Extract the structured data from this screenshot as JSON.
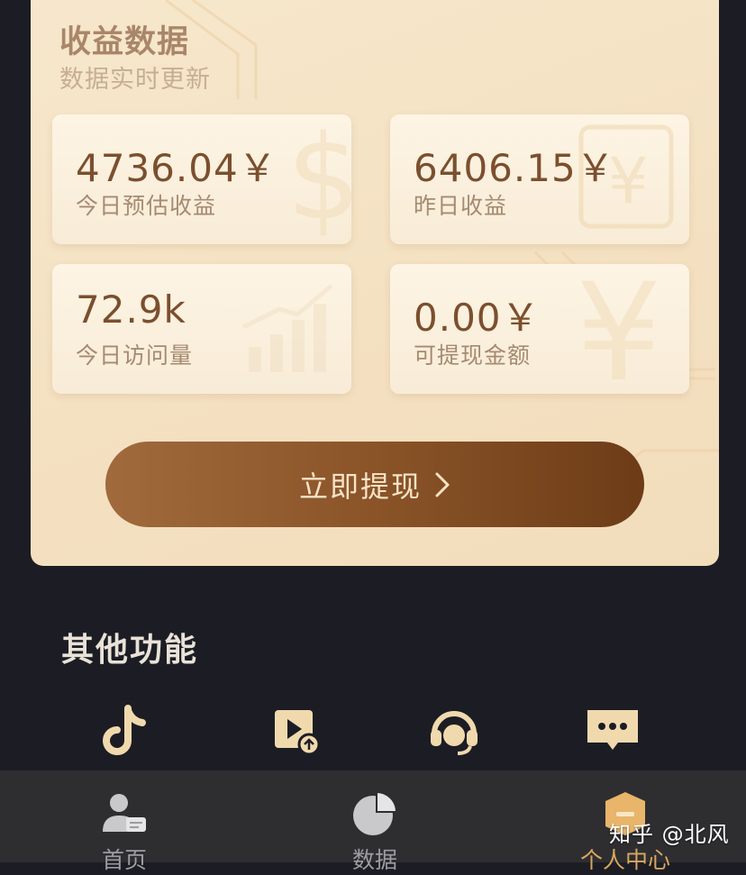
{
  "earnings_card": {
    "title": "收益数据",
    "subtitle": "数据实时更新",
    "stats": [
      {
        "value": "4736.04￥",
        "label": "今日预估收益"
      },
      {
        "value": "6406.15￥",
        "label": "昨日收益"
      },
      {
        "value": "72.9k",
        "label": "今日访问量"
      },
      {
        "value": "0.00￥",
        "label": "可提现金额"
      }
    ],
    "withdraw_label": "立即提现"
  },
  "other_functions": {
    "title": "其他功能",
    "items": [
      {
        "icon": "tiktok-icon"
      },
      {
        "icon": "video-upload-icon"
      },
      {
        "icon": "customer-service-icon"
      },
      {
        "icon": "message-icon"
      }
    ]
  },
  "tabbar": {
    "tabs": [
      {
        "label": "首页",
        "icon": "home-user-icon"
      },
      {
        "label": "数据",
        "icon": "pie-chart-icon"
      },
      {
        "label": "个人中心",
        "icon": "profile-shield-icon",
        "active": true
      }
    ]
  },
  "watermark": "知乎 @北风",
  "colors": {
    "card_background": "#f4e1c2",
    "accent_brown": "#7b4f2e",
    "button_brown": "#8a5428",
    "active_tab": "#d9a75e",
    "page_background": "#1c1d24"
  }
}
